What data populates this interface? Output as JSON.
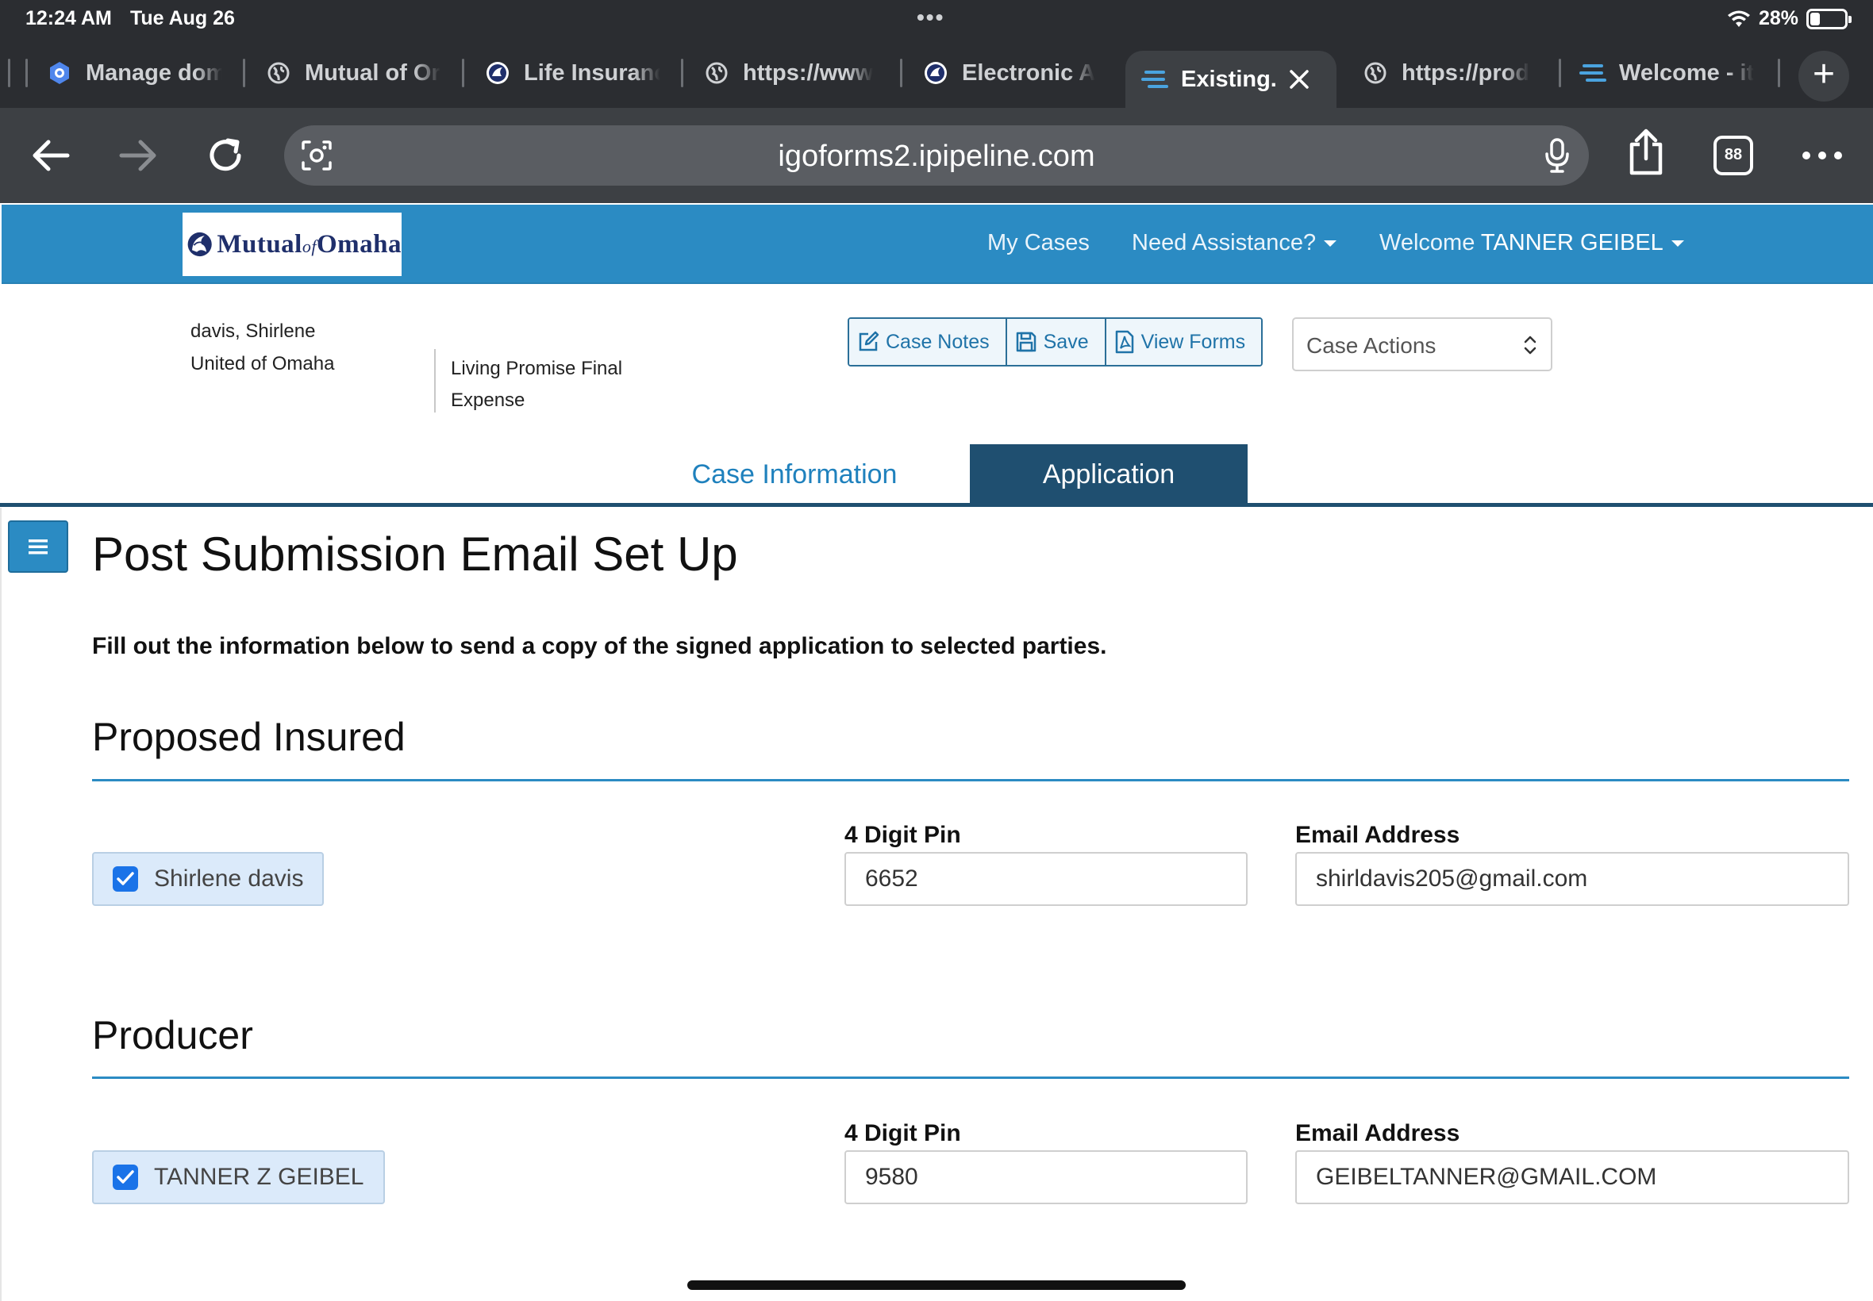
{
  "status_bar": {
    "time": "12:24 AM",
    "date": "Tue Aug 26",
    "battery": "28%",
    "battery_level": 0.28
  },
  "browser": {
    "tabs": [
      {
        "title": "Manage dom",
        "icon": "google-cloud-icon"
      },
      {
        "title": "Mutual of Or",
        "icon": "globe-icon"
      },
      {
        "title": "Life Insuranc",
        "icon": "mutual-of-omaha-icon"
      },
      {
        "title": "https://www",
        "icon": "globe-icon"
      },
      {
        "title": "Electronic A",
        "icon": "mutual-of-omaha-icon"
      },
      {
        "title": "Existing.",
        "icon": "ipipeline-icon",
        "active": true
      },
      {
        "title": "https://prod",
        "icon": "globe-icon"
      },
      {
        "title": "Welcome - it",
        "icon": "ipipeline-icon"
      }
    ],
    "url": "igoforms2.ipipeline.com",
    "tab_count": "88"
  },
  "site": {
    "logo_text": "Mutual",
    "logo_of": "of",
    "logo_text2": "Omaha",
    "nav_my_cases": "My Cases",
    "nav_assistance": "Need Assistance?",
    "nav_welcome": "Welcome",
    "nav_user": "TANNER GEIBEL"
  },
  "case": {
    "client_name": "davis, Shirlene",
    "company": "United of Omaha",
    "product": "Living Promise Final Expense",
    "btn_case_notes": "Case Notes",
    "btn_save": "Save",
    "btn_view_forms": "View Forms",
    "case_actions": "Case Actions",
    "tab_case_info": "Case Information",
    "tab_application": "Application"
  },
  "page": {
    "title": "Post Submission Email Set Up",
    "intro": "Fill out the information below to send a copy of the signed application to selected parties.",
    "pin_label": "4 Digit Pin",
    "email_label": "Email Address",
    "sections": [
      {
        "heading": "Proposed Insured",
        "name": "Shirlene davis",
        "checked": true,
        "pin": "6652",
        "email": "shirldavis205@gmail.com"
      },
      {
        "heading": "Producer",
        "name": "TANNER Z GEIBEL",
        "checked": true,
        "pin": "9580",
        "email": "GEIBELTANNER@GMAIL.COM"
      }
    ]
  },
  "colors": {
    "header_blue": "#2b8bc3",
    "tab_dark": "#1f4f70",
    "checkbox_blue": "#1a73e8",
    "browser_chrome": "#2b2d31"
  }
}
